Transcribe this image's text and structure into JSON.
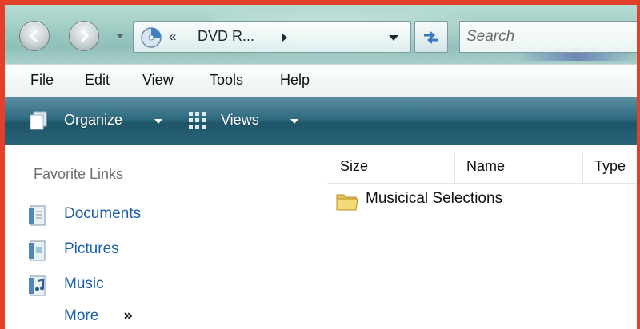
{
  "address_bar": {
    "chevrons": "«",
    "crumb": "DVD R...",
    "search_placeholder": "Search"
  },
  "menu": {
    "items": [
      "File",
      "Edit",
      "View",
      "Tools",
      "Help"
    ]
  },
  "command_bar": {
    "organize_label": "Organize",
    "views_label": "Views"
  },
  "navigation_pane": {
    "title": "Favorite Links",
    "links": [
      "Documents",
      "Pictures",
      "Music"
    ],
    "more_label": "More",
    "more_arrows": "»"
  },
  "file_list": {
    "columns": [
      "Size",
      "Name",
      "Type"
    ],
    "items": [
      {
        "name": "Musicical Selections",
        "icon": "folder-icon"
      }
    ]
  },
  "colors": {
    "frame": "#e2402a",
    "link": "#1b5fa8",
    "command_bar": "#2f6b80"
  },
  "icons": {
    "back": "back-arrow-icon",
    "forward": "forward-arrow-icon",
    "location": "dvd-drive-icon",
    "refresh": "refresh-icon",
    "organize": "organize-icon",
    "views": "views-icon"
  }
}
